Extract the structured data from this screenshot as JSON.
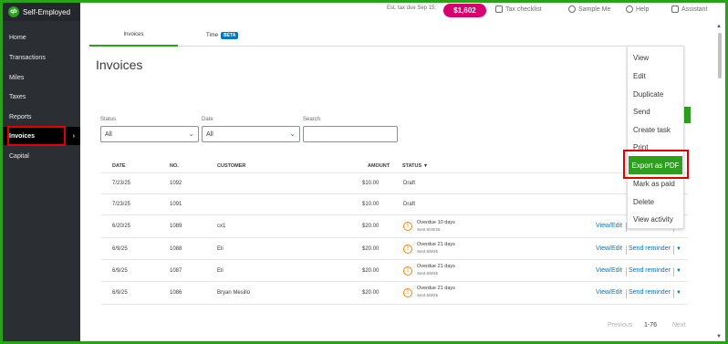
{
  "brand": {
    "logo": "qb",
    "name": "Self-Employed"
  },
  "sidebar": {
    "items": [
      {
        "label": "Home"
      },
      {
        "label": "Transactions"
      },
      {
        "label": "Miles"
      },
      {
        "label": "Taxes"
      },
      {
        "label": "Reports"
      },
      {
        "label": "Invoices"
      },
      {
        "label": "Capital"
      }
    ],
    "arrow": "›"
  },
  "topbar": {
    "est_tax_label": "Est. tax due Sep 15:",
    "est_tax_value": "$1,602",
    "tax_checklist": "Tax checklist",
    "sample_me": "Sample Me",
    "help": "Help",
    "assistant": "Assistant"
  },
  "tabs": [
    {
      "label": "Invoices"
    },
    {
      "label": "Time"
    }
  ],
  "tab_badge": "BETA",
  "page_title": "Invoices",
  "filters": {
    "status_label": "Status",
    "status_value": "All",
    "date_label": "Date",
    "date_value": "All",
    "search_label": "Search",
    "search_value": ""
  },
  "table": {
    "headers": [
      "DATE",
      "NO.",
      "CUSTOMER",
      "AMOUNT",
      "STATUS ▼"
    ],
    "rows": [
      {
        "date": "7/23/25",
        "no": "1092",
        "customer": "",
        "amount": "$10.00",
        "status": "Draft",
        "sub": "",
        "overdue": false
      },
      {
        "date": "7/23/25",
        "no": "1091",
        "customer": "",
        "amount": "$10.00",
        "status": "Draft",
        "sub": "",
        "overdue": false
      },
      {
        "date": "6/20/25",
        "no": "1089",
        "customer": "cx1",
        "amount": "$20.00",
        "status": "Overdue 10 days",
        "sub": "Sent 6/20/25",
        "overdue": true
      },
      {
        "date": "6/9/25",
        "no": "1088",
        "customer": "Eli",
        "amount": "$20.00",
        "status": "Overdue 21 days",
        "sub": "Sent 6/9/25",
        "overdue": true
      },
      {
        "date": "6/9/25",
        "no": "1087",
        "customer": "Eli",
        "amount": "$20.00",
        "status": "Overdue 21 days",
        "sub": "Sent 6/9/25",
        "overdue": true
      },
      {
        "date": "6/9/25",
        "no": "1086",
        "customer": "Bryan Mesillo",
        "amount": "$20.00",
        "status": "Overdue 21 days",
        "sub": "Sent 6/9/25",
        "overdue": true
      }
    ],
    "row_actions": {
      "view_edit": "View/Edit",
      "send_reminder": "Send reminder",
      "arrow": "▼"
    }
  },
  "pagination": {
    "previous": "Previous",
    "range": "1-76",
    "next": "Next"
  },
  "menu": {
    "items": [
      "View",
      "Edit",
      "Duplicate",
      "Send",
      "Create task",
      "Print",
      "Export as PDF",
      "Mark as paid",
      "Delete",
      "View activity"
    ]
  },
  "colors": {
    "brand_green": "#2ca01c",
    "highlight_red": "#e00000",
    "link_blue": "#0077c5",
    "tax_badge": "#d6006e",
    "warning": "#ff8000"
  }
}
